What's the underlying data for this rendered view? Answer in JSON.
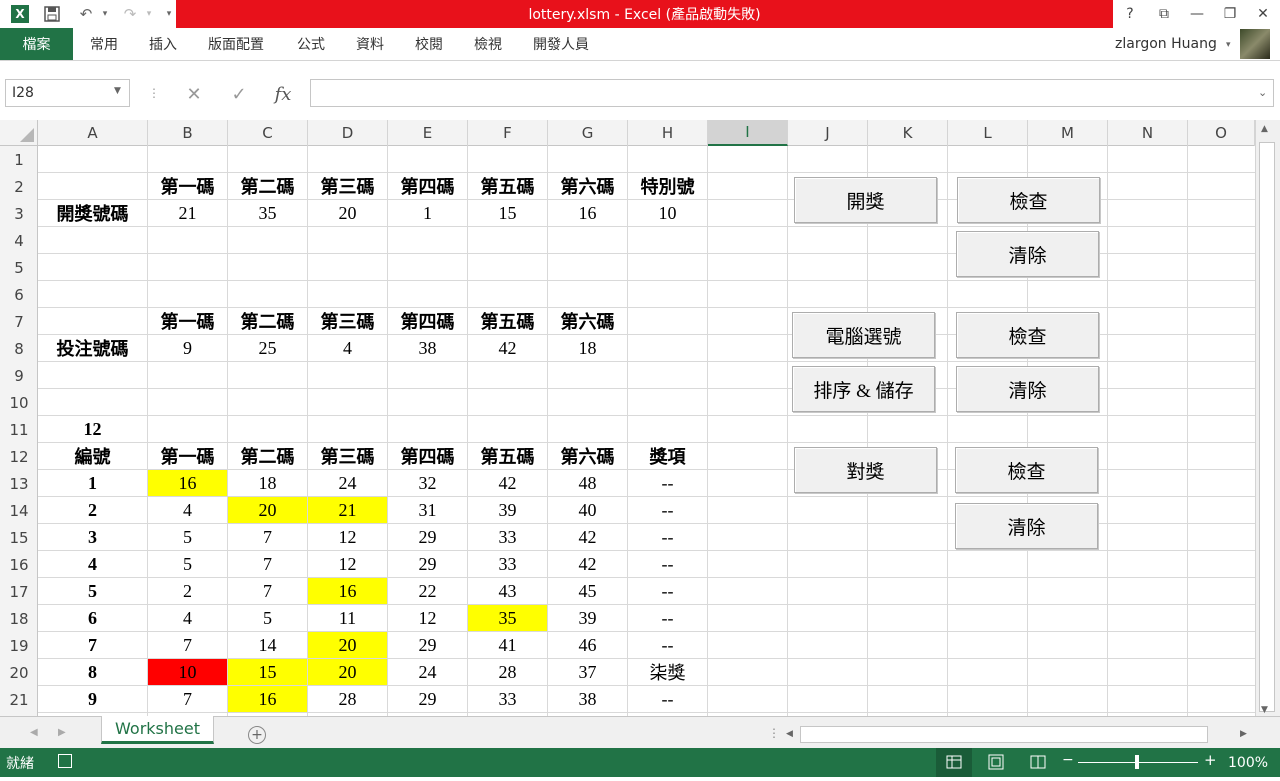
{
  "titlebar": {
    "title": "lottery.xlsm -  Excel (產品啟動失敗)",
    "help": "?",
    "restore_ribbon": "⧉",
    "minimize": "—",
    "maximize": "❐",
    "close": "✕"
  },
  "quick_access": {
    "app_icon": "X",
    "save_icon": "💾",
    "undo": "↶",
    "redo": "↷",
    "more": "▾"
  },
  "ribbon": {
    "file_tab": "檔案",
    "tabs": [
      "常用",
      "插入",
      "版面配置",
      "公式",
      "資料",
      "校閱",
      "檢視",
      "開發人員"
    ],
    "user": "zlargon Huang"
  },
  "formula_bar": {
    "name_box": "I28",
    "cancel": "✕",
    "enter": "✓",
    "fx": "fx",
    "content": ""
  },
  "columns": [
    "A",
    "B",
    "C",
    "D",
    "E",
    "F",
    "G",
    "H",
    "I",
    "J",
    "K",
    "L",
    "M",
    "N",
    "O"
  ],
  "selected_column": "I",
  "rows": [
    "1",
    "2",
    "3",
    "4",
    "5",
    "6",
    "7",
    "8",
    "9",
    "10",
    "11",
    "12",
    "13",
    "14",
    "15",
    "16",
    "17",
    "18",
    "19",
    "20",
    "21"
  ],
  "sheet": {
    "draw_header": [
      "第一碼",
      "第二碼",
      "第三碼",
      "第四碼",
      "第五碼",
      "第六碼",
      "特別號"
    ],
    "draw_label": "開獎號碼",
    "draw_values": [
      "21",
      "35",
      "20",
      "1",
      "15",
      "16",
      "10"
    ],
    "bet_header": [
      "第一碼",
      "第二碼",
      "第三碼",
      "第四碼",
      "第五碼",
      "第六碼"
    ],
    "bet_label": "投注號碼",
    "bet_values": [
      "9",
      "25",
      "4",
      "38",
      "42",
      "18"
    ],
    "count": "12",
    "table_header": [
      "編號",
      "第一碼",
      "第二碼",
      "第三碼",
      "第四碼",
      "第五碼",
      "第六碼",
      "獎項"
    ],
    "table_rows": [
      {
        "id": "1",
        "nums": [
          "16",
          "18",
          "24",
          "32",
          "42",
          "48"
        ],
        "prize": "--",
        "hl": [
          "y",
          "",
          "",
          "",
          "",
          ""
        ]
      },
      {
        "id": "2",
        "nums": [
          "4",
          "20",
          "21",
          "31",
          "39",
          "40"
        ],
        "prize": "--",
        "hl": [
          "",
          "y",
          "y",
          "",
          "",
          ""
        ]
      },
      {
        "id": "3",
        "nums": [
          "5",
          "7",
          "12",
          "29",
          "33",
          "42"
        ],
        "prize": "--",
        "hl": [
          "",
          "",
          "",
          "",
          "",
          ""
        ]
      },
      {
        "id": "4",
        "nums": [
          "5",
          "7",
          "12",
          "29",
          "33",
          "42"
        ],
        "prize": "--",
        "hl": [
          "",
          "",
          "",
          "",
          "",
          ""
        ]
      },
      {
        "id": "5",
        "nums": [
          "2",
          "7",
          "16",
          "22",
          "43",
          "45"
        ],
        "prize": "--",
        "hl": [
          "",
          "",
          "y",
          "",
          "",
          ""
        ]
      },
      {
        "id": "6",
        "nums": [
          "4",
          "5",
          "11",
          "12",
          "35",
          "39"
        ],
        "prize": "--",
        "hl": [
          "",
          "",
          "",
          "",
          "y",
          ""
        ]
      },
      {
        "id": "7",
        "nums": [
          "7",
          "14",
          "20",
          "29",
          "41",
          "46"
        ],
        "prize": "--",
        "hl": [
          "",
          "",
          "y",
          "",
          "",
          ""
        ]
      },
      {
        "id": "8",
        "nums": [
          "10",
          "15",
          "20",
          "24",
          "28",
          "37"
        ],
        "prize": "柒獎",
        "hl": [
          "r",
          "y",
          "y",
          "",
          "",
          ""
        ]
      },
      {
        "id": "9",
        "nums": [
          "7",
          "16",
          "28",
          "29",
          "33",
          "38"
        ],
        "prize": "--",
        "hl": [
          "",
          "y",
          "",
          "",
          "",
          ""
        ]
      }
    ]
  },
  "buttons": {
    "draw": "開獎",
    "draw_check": "檢查",
    "draw_clear": "清除",
    "auto_pick": "電腦選號",
    "bet_check": "檢查",
    "sort_save": "排序 & 儲存",
    "bet_clear": "清除",
    "redeem": "對獎",
    "redeem_check": "檢查",
    "redeem_clear": "清除"
  },
  "sheet_tabs": {
    "active": "Worksheet",
    "add": "+"
  },
  "statusbar": {
    "text": "就緒",
    "zoom": "100%"
  },
  "colors": {
    "excel_green": "#217346",
    "title_red": "#e8111b",
    "highlight_yellow": "#ffff00",
    "highlight_red": "#ff0000"
  }
}
